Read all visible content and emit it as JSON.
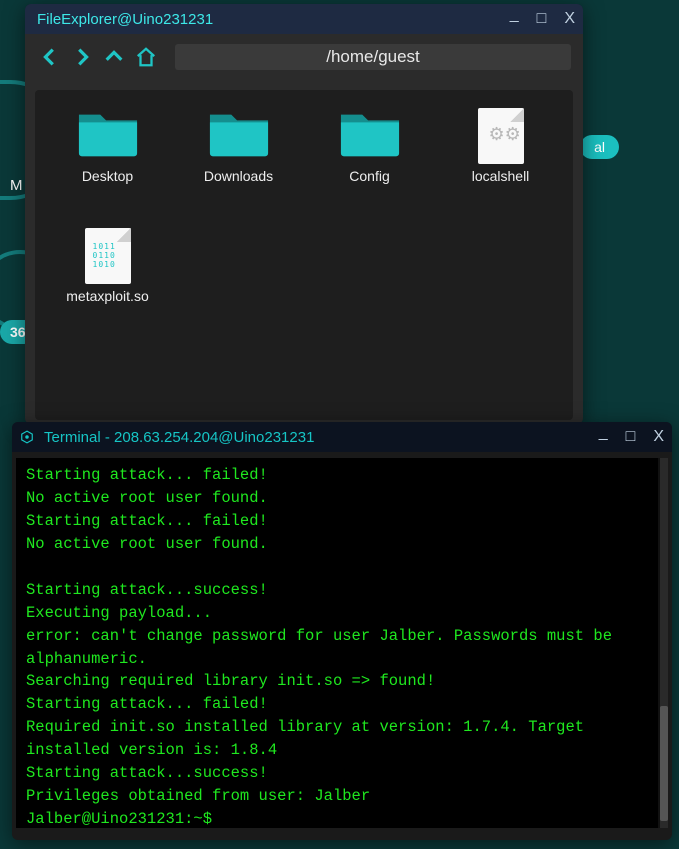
{
  "desktop": {
    "badge": "36",
    "pill_suffix": "al",
    "label_char": "M"
  },
  "fileExplorer": {
    "title": "FileExplorer@Uino231231",
    "path": "/home/guest",
    "items": [
      {
        "name": "Desktop",
        "type": "folder"
      },
      {
        "name": "Downloads",
        "type": "folder"
      },
      {
        "name": "Config",
        "type": "folder"
      },
      {
        "name": "localshell",
        "type": "file-gears"
      },
      {
        "name": "metaxploit.so",
        "type": "file-bin"
      }
    ]
  },
  "terminal": {
    "title": "Terminal - 208.63.254.204@Uino231231",
    "lines": [
      "Starting attack... failed!",
      "No active root user found.",
      "Starting attack... failed!",
      "No active root user found.",
      "",
      "Starting attack...success!",
      "Executing payload...",
      "error: can't change password for user Jalber. Passwords must be alphanumeric.",
      "Searching required library init.so => found!",
      "Starting attack... failed!",
      "Required init.so installed library at version: 1.7.4. Target installed version is: 1.8.4",
      "Starting attack...success!",
      "Privileges obtained from user: Jalber",
      "Jalber@Uino231231:~$ "
    ],
    "scroll": {
      "thumbTop": 248,
      "thumbHeight": 115
    }
  }
}
